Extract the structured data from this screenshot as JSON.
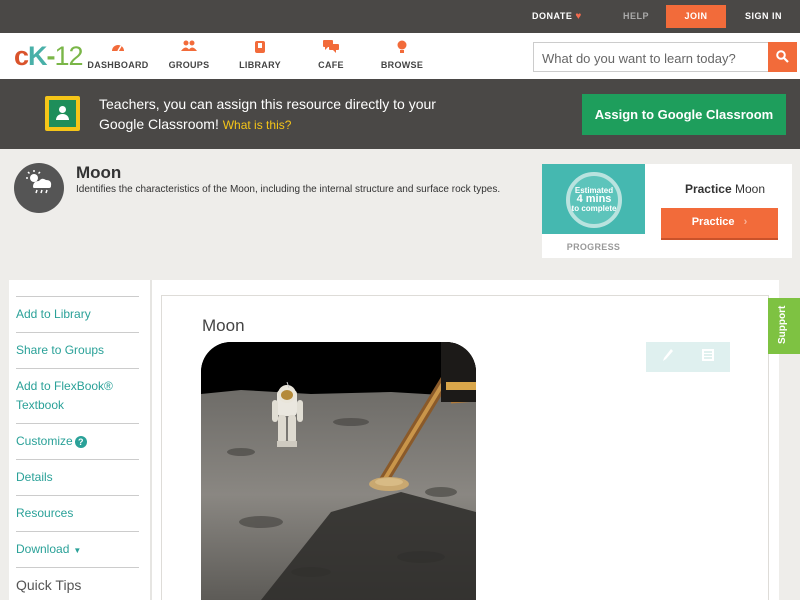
{
  "topbar": {
    "donate": "DONATE",
    "help": "HELP",
    "join": "JOIN",
    "signin": "SIGN IN"
  },
  "logo": {
    "c": "c",
    "k": "K",
    "dash": "-",
    "num": "12"
  },
  "nav": {
    "items": [
      {
        "label": "DASHBOARD",
        "icon": "dashboard-icon"
      },
      {
        "label": "GROUPS",
        "icon": "groups-icon"
      },
      {
        "label": "LIBRARY",
        "icon": "library-icon"
      },
      {
        "label": "CAFE",
        "icon": "cafe-icon"
      },
      {
        "label": "BROWSE",
        "icon": "browse-icon"
      }
    ]
  },
  "search": {
    "placeholder": "What do you want to learn today?",
    "value": ""
  },
  "banner": {
    "text": "Teachers, you can assign this resource directly to your Google Classroom!",
    "what_link": "What is this?",
    "assign_button": "Assign to Google Classroom"
  },
  "concept": {
    "title": "Moon",
    "description": "Identifies the characteristics of the Moon, including the internal structure and surface rock types."
  },
  "practice": {
    "estimated_label": "Estimated",
    "estimated_value": "4 mins",
    "estimated_suffix": "to complete",
    "progress_label": "PROGRESS",
    "title_bold": "Practice",
    "title_rest": "Moon",
    "button": "Practice"
  },
  "sidebar": {
    "items": [
      {
        "label": "Add to Library"
      },
      {
        "label": "Share to Groups"
      },
      {
        "label": "Add to FlexBook® Textbook"
      },
      {
        "label": "Customize"
      },
      {
        "label": "Details"
      },
      {
        "label": "Resources"
      },
      {
        "label": "Download"
      },
      {
        "label": "Quick Tips"
      }
    ]
  },
  "article": {
    "title": "Moon"
  },
  "support": {
    "label": "Support"
  },
  "colors": {
    "accent_orange": "#f26b3a",
    "dark_bar": "#4a4846",
    "teal_link": "#2aa198",
    "classroom_green": "#1e9e5c",
    "support_green": "#7ec242"
  }
}
